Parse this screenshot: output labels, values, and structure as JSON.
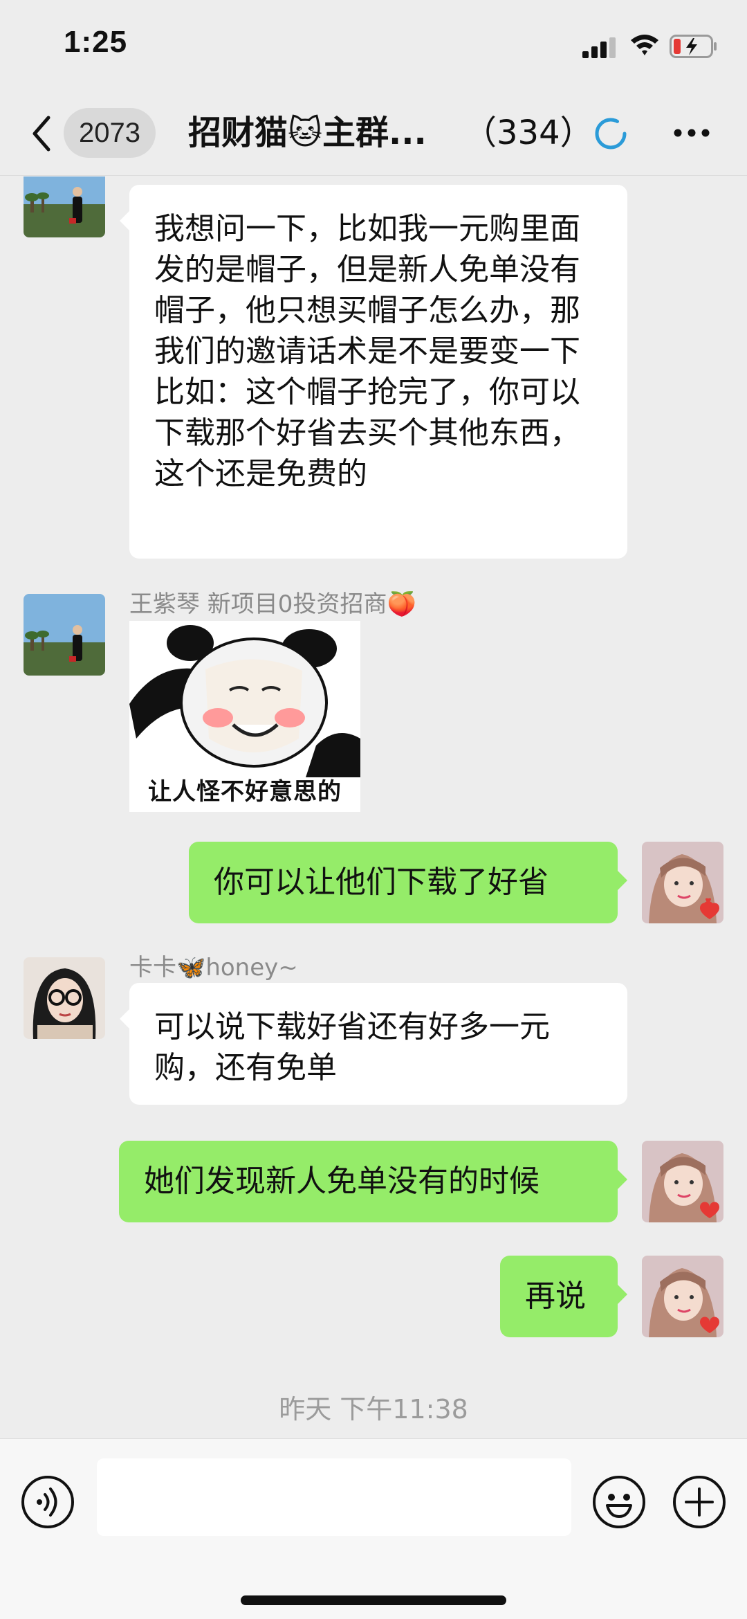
{
  "status_bar": {
    "time": "1:25"
  },
  "nav": {
    "unread_count": "2073",
    "title": "招财猫🐱主群...",
    "member_count": "（334）"
  },
  "messages": [
    {
      "direction": "in",
      "text": "我想问一下，比如我一元购里面发的是帽子，但是新人免单没有帽子，他只想买帽子怎么办，那我们的邀请话术是不是要变一下\n比如：这个帽子抢完了，你可以下载那个好省去买个其他东西，这个还是免费的"
    },
    {
      "direction": "in",
      "sender": "王紫琴 新项目0投资招商🍑",
      "sticker_caption": "让人怪不好意思的"
    },
    {
      "direction": "out",
      "text": "你可以让他们下载了好省"
    },
    {
      "direction": "in",
      "sender": "卡卡🦋honey~",
      "text": "可以说下载好省还有好多一元购，还有免单"
    },
    {
      "direction": "out",
      "text": "她们发现新人免单没有的时候"
    },
    {
      "direction": "out",
      "text": "再说"
    }
  ],
  "time_divider": "昨天 下午11:38",
  "icons": {
    "back": "chevron-left-icon",
    "loading": "loading-ring-icon",
    "more": "more-dots-icon",
    "voice": "voice-icon",
    "emoji": "emoji-icon",
    "plus": "plus-circle-icon"
  },
  "colors": {
    "background": "#ededed",
    "outgoing_bubble": "#95ec69",
    "incoming_bubble": "#ffffff",
    "accent": "#2b9bd8"
  }
}
